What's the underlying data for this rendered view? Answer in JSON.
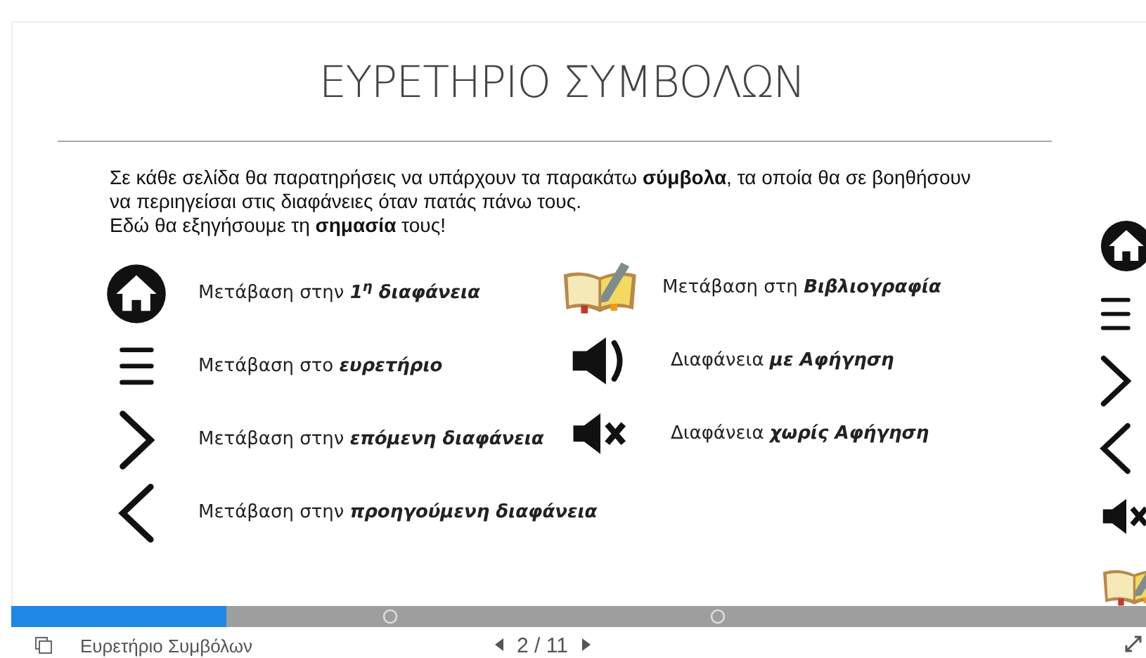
{
  "slide": {
    "title": "ΕΥΡΕΤΗΡΙΟ ΣΥΜΒΟΛΩΝ",
    "intro": [
      "Σε κάθε σελίδα θα παρατηρήσεις να υπάρχουν τα παρακάτω **σύμβολα**, τα οποία θα σε βοηθήσουν να περιηγείσαι στις διαφάνειες όταν πατάς πάνω τους.",
      "Εδώ θα εξηγήσουμε τη **σημασία** τους!"
    ],
    "left_items": [
      {
        "kind": "home",
        "prefix": "Μετάβαση στην",
        "emphasis": "1$^{η}$ διαφάνεια"
      },
      {
        "kind": "menu",
        "prefix": "Μετάβαση στο",
        "emphasis": "ευρετήριο"
      },
      {
        "kind": "next",
        "prefix": "Μετάβαση στην",
        "emphasis": "επόμενη διαφάνεια"
      },
      {
        "kind": "prev",
        "prefix": "Μετάβαση στην",
        "emphasis": "προηγούμενη διαφάνεια"
      }
    ],
    "right_items": [
      {
        "kind": "book",
        "prefix": "Μετάβαση στη",
        "emphasis": "Βιβλιογραφία"
      },
      {
        "kind": "sound",
        "prefix": "Διαφάνεια",
        "emphasis": "με Αφήγηση"
      },
      {
        "kind": "mute",
        "prefix": "Διαφάνεια",
        "emphasis": "χωρίς Αφήγηση"
      }
    ],
    "next_slide_icons": [
      {
        "kind": "home"
      },
      {
        "kind": "menu"
      },
      {
        "kind": "next"
      },
      {
        "kind": "prev"
      },
      {
        "kind": "mute"
      },
      {
        "kind": "book"
      }
    ]
  },
  "progress": {
    "level": 0.19
  },
  "footer": {
    "slide_title": "Ευρετήριο Συμβόλων",
    "page": "2 / 11"
  }
}
